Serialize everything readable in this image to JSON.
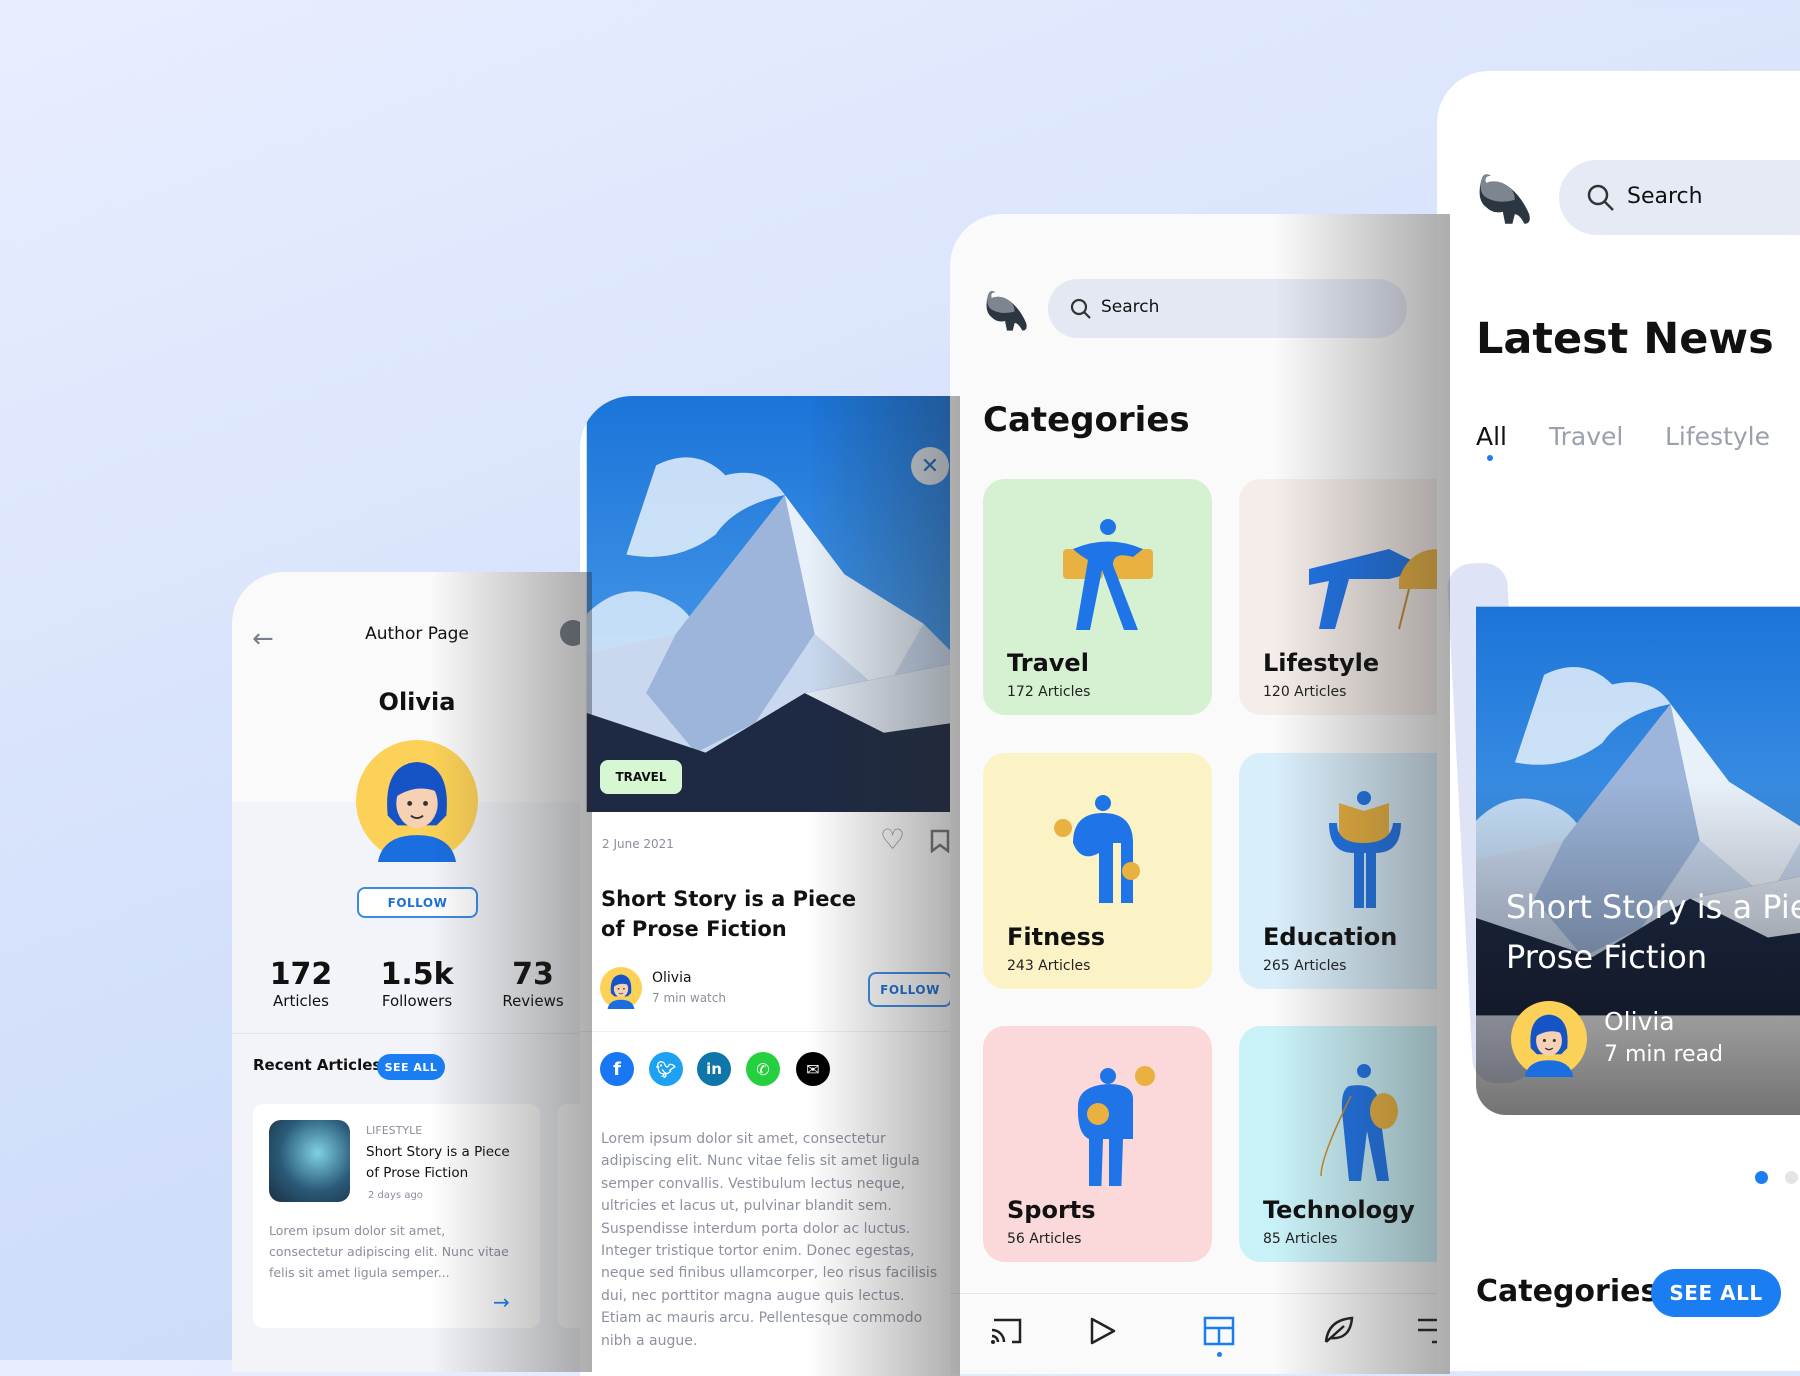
{
  "author_page": {
    "title": "Author Page",
    "name": "Olivia",
    "follow_label": "FOLLOW",
    "stats": [
      {
        "value": "172",
        "label": "Articles"
      },
      {
        "value": "1.5k",
        "label": "Followers"
      },
      {
        "value": "73",
        "label": "Reviews"
      }
    ],
    "recent_title": "Recent Articles",
    "see_all_label": "SEE ALL",
    "article": {
      "category": "LIFESTYLE",
      "title_line1": "Short Story is a Piece",
      "title_line2": "of Prose Fiction",
      "time": "2 days ago",
      "excerpt_lines": [
        "Lorem ipsum dolor sit amet,",
        "consectetur adipiscing elit. Nunc vitae",
        "felis sit amet ligula semper..."
      ]
    }
  },
  "article_page": {
    "tag": "TRAVEL",
    "date": "2 June 2021",
    "title_line1": "Short Story is a Piece",
    "title_line2": "of Prose Fiction",
    "author": "Olivia",
    "duration": "7 min watch",
    "follow_label": "FOLLOW",
    "share": [
      "facebook",
      "twitter",
      "linkedin",
      "whatsapp",
      "email"
    ],
    "body_lines": [
      "Lorem ipsum dolor sit amet, consectetur",
      "adipiscing elit. Nunc vitae felis sit amet ligula",
      "semper convallis. Vestibulum lectus neque,",
      "ultricies et lacus ut, pulvinar blandit sem.",
      "Suspendisse interdum porta dolor ac luctus.",
      "Integer tristique tortor enim. Donec egestas,",
      "neque sed finibus ullamcorper, leo risus facilisis",
      "dui, nec porttitor magna augue quis lectus.",
      "Etiam ac mauris arcu. Pellentesque commodo",
      "nibh a augue."
    ]
  },
  "categories_page": {
    "search_placeholder": "Search",
    "title": "Categories",
    "categories": [
      {
        "name": "Travel",
        "count": "172 Articles",
        "color": "#d6f1d2"
      },
      {
        "name": "Lifestyle",
        "count": "120 Articles",
        "color": "#f5ede9"
      },
      {
        "name": "Fitness",
        "count": "243 Articles",
        "color": "#fbf3c6"
      },
      {
        "name": "Education",
        "count": "265 Articles",
        "color": "#d9eefb"
      },
      {
        "name": "Sports",
        "count": "56 Articles",
        "color": "#fbd8d9"
      },
      {
        "name": "Technology",
        "count": "85 Articles",
        "color": "#c9f1f8"
      }
    ],
    "nav": [
      "cast-icon",
      "play-icon",
      "dashboard-icon",
      "leaf-icon",
      "menu-icon"
    ],
    "nav_active": "dashboard-icon"
  },
  "news_page": {
    "search_placeholder": "Search",
    "title": "Latest News",
    "tabs": [
      "All",
      "Travel",
      "Lifestyle"
    ],
    "active_tab": "All",
    "featured": {
      "title_line1": "Short Story is a Pie",
      "title_line2": "Prose Fiction",
      "author": "Olivia",
      "read_time": "7 min read"
    },
    "carousel_active": 1,
    "categories_title": "Categories",
    "see_all_label": "SEE ALL"
  },
  "colors": {
    "accent": "#1a7ef2",
    "illustration_blue": "#1f74e8",
    "illustration_gold": "#e9b13f"
  }
}
